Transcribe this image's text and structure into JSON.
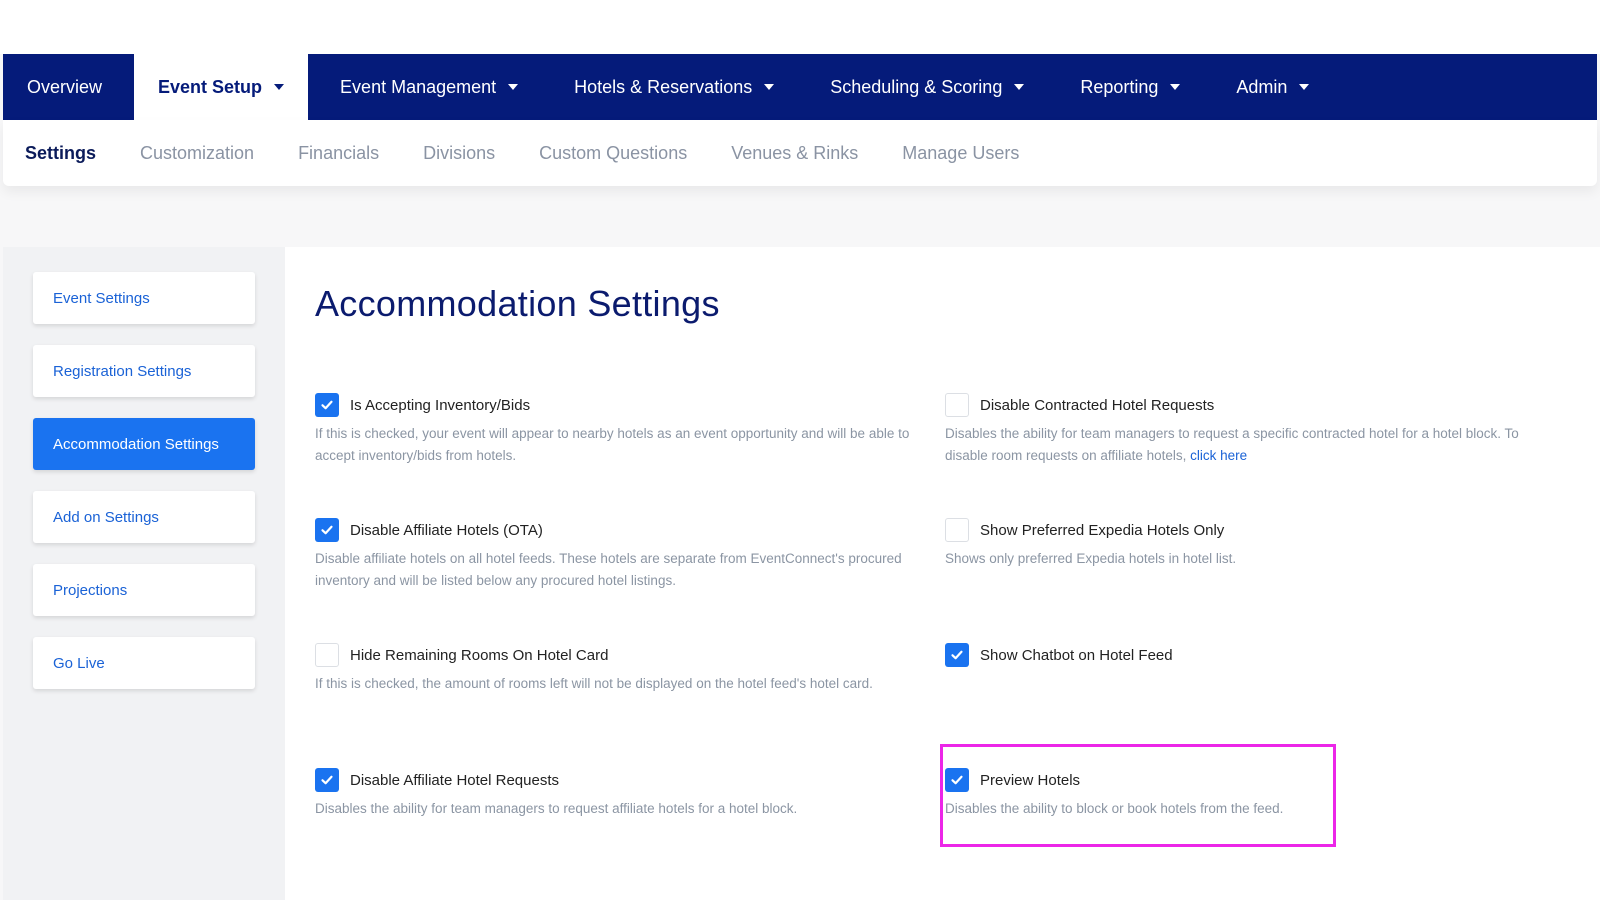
{
  "nav": {
    "items": [
      {
        "label": "Overview",
        "dropdown": false,
        "active": false
      },
      {
        "label": "Event Setup",
        "dropdown": true,
        "active": true
      },
      {
        "label": "Event Management",
        "dropdown": true,
        "active": false
      },
      {
        "label": "Hotels & Reservations",
        "dropdown": true,
        "active": false
      },
      {
        "label": "Scheduling & Scoring",
        "dropdown": true,
        "active": false
      },
      {
        "label": "Reporting",
        "dropdown": true,
        "active": false
      },
      {
        "label": "Admin",
        "dropdown": true,
        "active": false
      }
    ]
  },
  "subnav": {
    "items": [
      {
        "label": "Settings",
        "active": true
      },
      {
        "label": "Customization",
        "active": false
      },
      {
        "label": "Financials",
        "active": false
      },
      {
        "label": "Divisions",
        "active": false
      },
      {
        "label": "Custom Questions",
        "active": false
      },
      {
        "label": "Venues & Rinks",
        "active": false
      },
      {
        "label": "Manage Users",
        "active": false
      }
    ]
  },
  "sidebar": {
    "items": [
      {
        "label": "Event Settings",
        "active": false
      },
      {
        "label": "Registration Settings",
        "active": false
      },
      {
        "label": "Accommodation Settings",
        "active": true
      },
      {
        "label": "Add on Settings",
        "active": false
      },
      {
        "label": "Projections",
        "active": false
      },
      {
        "label": "Go Live",
        "active": false
      }
    ]
  },
  "main": {
    "title": "Accommodation Settings",
    "settings": [
      {
        "label": "Is Accepting Inventory/Bids",
        "checked": true,
        "desc": "If this is checked, your event will appear to nearby hotels as an event opportunity and will be able to accept inventory/bids from hotels."
      },
      {
        "label": "Disable Contracted Hotel Requests",
        "checked": false,
        "desc": "Disables the ability for team managers to request a specific contracted hotel for a hotel block. To disable room requests on affiliate hotels,",
        "link": "click here"
      },
      {
        "label": "Disable Affiliate Hotels (OTA)",
        "checked": true,
        "desc": "Disable affiliate hotels on all hotel feeds. These hotels are separate from EventConnect's procured inventory and will be listed below any procured hotel listings."
      },
      {
        "label": "Show Preferred Expedia Hotels Only",
        "checked": false,
        "desc": "Shows only preferred Expedia hotels in hotel list."
      },
      {
        "label": "Hide Remaining Rooms On Hotel Card",
        "checked": false,
        "desc": "If this is checked, the amount of rooms left will not be displayed on the hotel feed's hotel card."
      },
      {
        "label": "Show Chatbot on Hotel Feed",
        "checked": true,
        "desc": ""
      },
      {
        "label": "Disable Affiliate Hotel Requests",
        "checked": true,
        "desc": "Disables the ability for team managers to request affiliate hotels for a hotel block."
      },
      {
        "label": "Preview Hotels",
        "checked": true,
        "desc": "Disables the ability to block or book hotels from the feed."
      }
    ]
  },
  "colors": {
    "nav_bg": "#051b7a",
    "accent": "#1a73f0",
    "highlight": "#ec26e8"
  }
}
